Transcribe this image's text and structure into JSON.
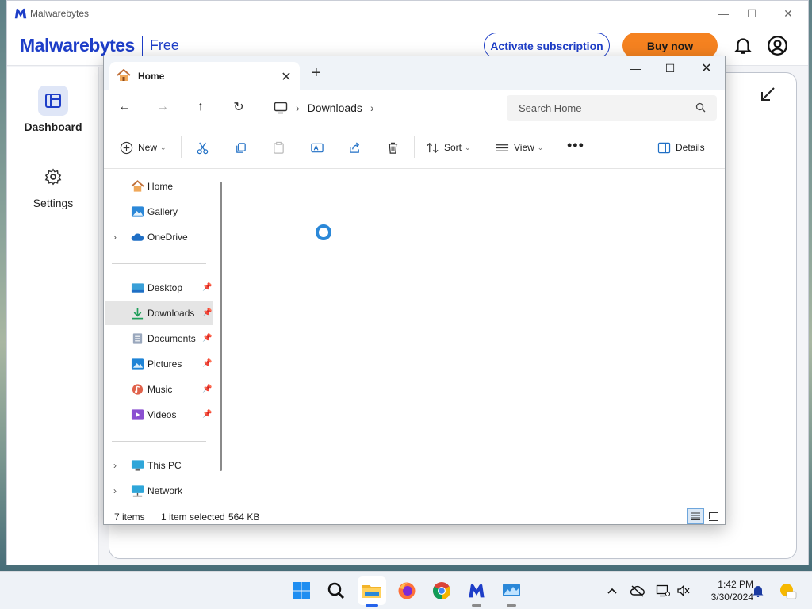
{
  "malwarebytes": {
    "window_title": "Malwarebytes",
    "brand_name": "Malwarebytes",
    "edition": "Free",
    "activate_label": "Activate subscription",
    "buy_label": "Buy now",
    "sidebar": [
      {
        "label": "Dashboard",
        "icon": "dashboard-icon"
      },
      {
        "label": "Settings",
        "icon": "gear-icon"
      }
    ],
    "accent": "#1e3ec8",
    "buy_color": "#f58220"
  },
  "explorer": {
    "tab_label": "Home",
    "breadcrumb": {
      "location": "Downloads"
    },
    "search_placeholder": "Search Home",
    "commands": {
      "new": "New",
      "sort": "Sort",
      "view": "View",
      "details": "Details"
    },
    "nav": {
      "home": "Home",
      "gallery": "Gallery",
      "onedrive": "OneDrive",
      "desktop": "Desktop",
      "downloads": "Downloads",
      "documents": "Documents",
      "pictures": "Pictures",
      "music": "Music",
      "videos": "Videos",
      "thispc": "This PC",
      "network": "Network"
    },
    "status": {
      "count": "7 items",
      "selected": "1 item selected",
      "size": "564 KB"
    }
  },
  "taskbar": {
    "apps": [
      "windows-start-icon",
      "search-icon",
      "file-explorer-icon",
      "firefox-icon",
      "chrome-icon",
      "malwarebytes-icon",
      "monitor-app-icon"
    ],
    "time": "1:42 PM",
    "date": "3/30/2024"
  }
}
